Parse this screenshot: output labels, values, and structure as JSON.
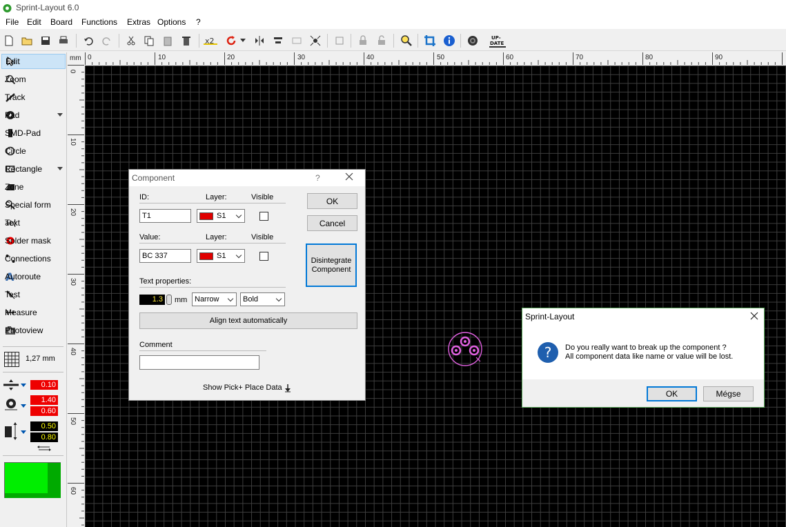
{
  "window": {
    "title": "Sprint-Layout 6.0"
  },
  "menu": [
    "File",
    "Edit",
    "Board",
    "Functions",
    "Extras",
    "Options",
    "?"
  ],
  "tools": [
    {
      "label": "Edit",
      "icon": "pointer-icon",
      "active": true
    },
    {
      "label": "Zoom",
      "icon": "magnifier-icon"
    },
    {
      "label": "Track",
      "icon": "track-icon"
    },
    {
      "label": "Pad",
      "icon": "pad-icon",
      "dropdown": true
    },
    {
      "label": "SMD-Pad",
      "icon": "smd-pad-icon"
    },
    {
      "label": "Circle",
      "icon": "circle-icon"
    },
    {
      "label": "Rectangle",
      "icon": "rectangle-icon",
      "dropdown": true
    },
    {
      "label": "Zone",
      "icon": "zone-icon"
    },
    {
      "label": "Special form",
      "icon": "special-form-icon"
    },
    {
      "label": "Text",
      "icon": "text-icon"
    },
    {
      "label": "Solder mask",
      "icon": "solder-mask-icon"
    },
    {
      "label": "Connections",
      "icon": "connections-icon"
    },
    {
      "label": "Autoroute",
      "icon": "autoroute-icon"
    },
    {
      "label": "Test",
      "icon": "test-icon"
    },
    {
      "label": "Measure",
      "icon": "measure-icon"
    },
    {
      "label": "Photoview",
      "icon": "photoview-icon"
    }
  ],
  "grid": {
    "label": "1,27 mm"
  },
  "track_width": "0.10",
  "pad_outer": "1.40",
  "pad_inner": "0.60",
  "smd_width": "0.50",
  "smd_height": "0.80",
  "colors": {
    "canvas": "#000000",
    "layer_red": "#e00000",
    "active_layer": "#00ee00",
    "component": "#e060e0",
    "accent": "#0078d7"
  },
  "ruler": {
    "unit": "mm",
    "top_labels": [
      "0",
      "10",
      "20",
      "30",
      "40",
      "50",
      "60",
      "70",
      "80",
      "90"
    ],
    "left_labels": [
      "0",
      "10",
      "20",
      "30",
      "40",
      "50",
      "60"
    ]
  },
  "component_dialog": {
    "title": "Component",
    "help": "?",
    "id_label": "ID:",
    "id_value": "T1",
    "layer_label": "Layer:",
    "layer_value": "S1",
    "visible_label": "Visible",
    "value_label": "Value:",
    "value_value": "BC 337",
    "layer2_value": "S1",
    "text_props_label": "Text properties:",
    "text_size": "1.3",
    "unit": "mm",
    "width_option": "Narrow",
    "weight_option": "Bold",
    "align_label": "Align text automatically",
    "comment_label": "Comment",
    "comment_value": "",
    "pick_place_label": "Show Pick+ Place Data",
    "ok": "OK",
    "cancel": "Cancel",
    "disintegrate": "Disintegrate Component"
  },
  "confirm_dialog": {
    "title": "Sprint-Layout",
    "line1": "Do you really want to break up the component ?",
    "line2": "All component data like name or value will be lost.",
    "ok": "OK",
    "cancel": "Mégse"
  }
}
